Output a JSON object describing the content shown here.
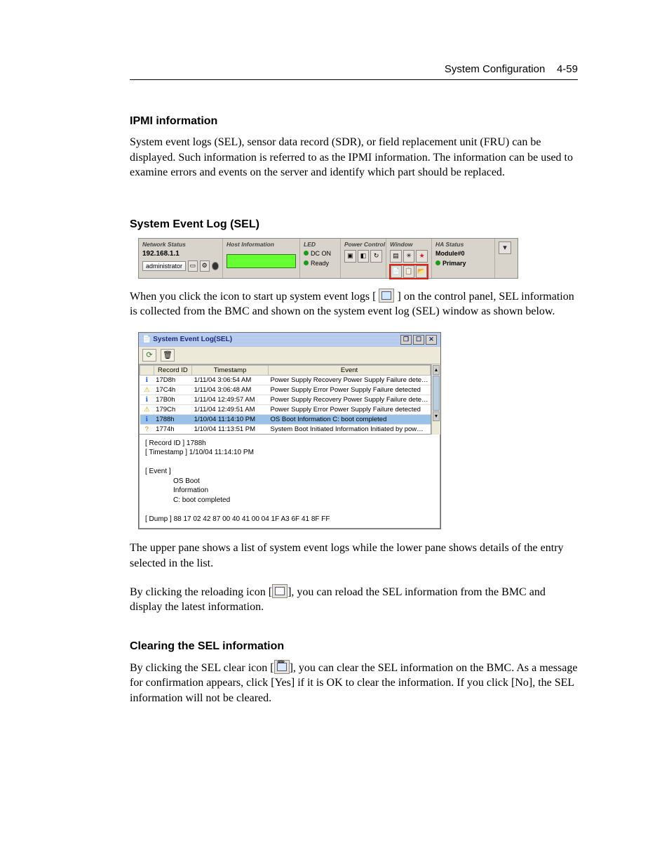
{
  "header": {
    "title": "System Configuration",
    "pagenum": "4-59"
  },
  "sec1": {
    "title": "IPMI information",
    "para": "System event logs (SEL), sensor data record (SDR), or field replacement unit (FRU) can be displayed. Such information is referred to as the IPMI information. The information can be used to examine errors and events on the server and identify which part should be replaced."
  },
  "sec2": {
    "title": "System Event Log (SEL)",
    "para_a": "When you click the icon to start up system event logs [",
    "para_b": "] on the control panel, SEL information is collected from the BMC and shown on the system event log (SEL) window as shown below."
  },
  "strip": {
    "net_head": "Network Status",
    "ip": "192.168.1.1",
    "admin": "administrator",
    "host_head": "Host Information",
    "led_head": "LED",
    "dc_on": "DC ON",
    "ready": "Ready",
    "pc_head": "Power Control",
    "win_head": "Window",
    "ha_head": "HA Status",
    "module": "Module#0",
    "primary": "Primary"
  },
  "sel": {
    "title": "System Event Log(SEL)",
    "cols": {
      "rec": "Record ID",
      "ts": "Timestamp",
      "ev": "Event"
    },
    "rows": [
      {
        "ic": "info",
        "id": "17D8h",
        "ts": "1/11/04 3:06:54 AM",
        "ev": "Power Supply    Recovery    Power Supply Failure dete…"
      },
      {
        "ic": "warn",
        "id": "17C4h",
        "ts": "1/11/04 3:06:48 AM",
        "ev": "Power Supply    Error    Power Supply Failure detected"
      },
      {
        "ic": "info",
        "id": "17B0h",
        "ts": "1/11/04 12:49:57 AM",
        "ev": "Power Supply    Recovery    Power Supply Failure dete…"
      },
      {
        "ic": "warn",
        "id": "179Ch",
        "ts": "1/11/04 12:49:51 AM",
        "ev": "Power Supply    Error    Power Supply Failure detected"
      },
      {
        "ic": "info",
        "id": "1788h",
        "ts": "1/10/04 11:14:10 PM",
        "ev": "OS Boot    Information    C: boot completed",
        "sel": true
      },
      {
        "ic": "q",
        "id": "1774h",
        "ts": "1/10/04 11:13:51 PM",
        "ev": "System Boot Initiated    Information    Initiated by pow…"
      }
    ],
    "detail": {
      "l1": "[ Record ID ]    1788h",
      "l2": "[ Timestamp ]  1/10/04 11:14:10 PM",
      "l3": "[ Event ]",
      "l4": "OS Boot",
      "l5": "Information",
      "l6": "C: boot completed",
      "l7": "[ Dump ]    88 17 02 42   87 00 40 41   00 04 1F A3   6F 41 8F FF"
    }
  },
  "after1": "The upper pane shows a list of system event logs while the lower pane shows details of the entry selected in the list.",
  "after2a": "By clicking the reloading icon [",
  "after2b": "], you can reload the SEL information from the BMC and display the latest information.",
  "sec3": {
    "title": "Clearing the SEL information",
    "pa": "By clicking the SEL clear icon [",
    "pb": "], you can clear the SEL information on the BMC. As a message for confirmation appears, click [Yes] if it is OK to clear the information. If you click [No], the SEL information will not be cleared."
  }
}
